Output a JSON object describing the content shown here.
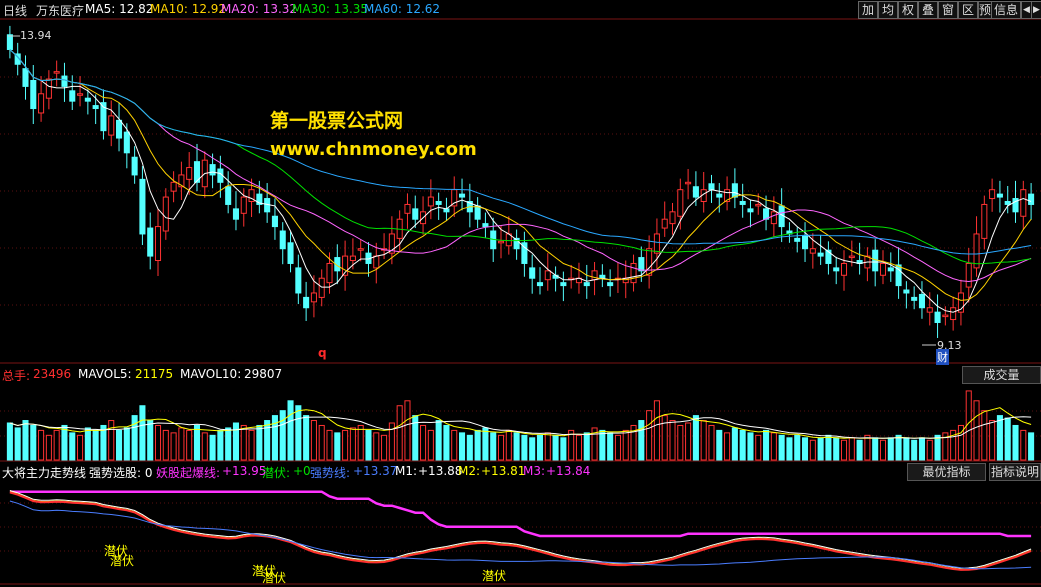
{
  "header": {
    "period": "日线",
    "stock": "万东医疗",
    "ma": [
      {
        "label": "MA5:",
        "value": "12.82",
        "color": "#ffffff"
      },
      {
        "label": "MA10:",
        "value": "12.92",
        "color": "#ffd200"
      },
      {
        "label": "MA20:",
        "value": "13.32",
        "color": "#ff66ff"
      },
      {
        "label": "MA30:",
        "value": "13.35",
        "color": "#00e000"
      },
      {
        "label": "MA60:",
        "value": "12.62",
        "color": "#2aa8ff"
      }
    ],
    "buttons": [
      "加",
      "均",
      "权",
      "叠",
      "窗",
      "区",
      "预",
      "信息"
    ],
    "nav_left": "◀",
    "nav_right": "▶"
  },
  "price_panel": {
    "high_label": "13.94",
    "low_label": "9.13",
    "q_marker": "q",
    "cai_marker": "财"
  },
  "watermark": {
    "line1": "第一股票公式网",
    "line2": "www.chnmoney.com"
  },
  "volume_panel": {
    "labels": [
      {
        "text": "总手:",
        "color": "#ff3030"
      },
      {
        "text": "23496",
        "color": "#ff3030"
      },
      {
        "text": "MAVOL5:",
        "color": "#ffffff"
      },
      {
        "text": "21175",
        "color": "#ffff00"
      },
      {
        "text": "MAVOL10:",
        "color": "#ffffff"
      },
      {
        "text": "29807",
        "color": "#ffffff"
      }
    ],
    "button": "成交量"
  },
  "indicator_panel": {
    "labels": [
      {
        "text": "大将主力走势线",
        "color": "#ffffff"
      },
      {
        "text": "强势选股: 0",
        "color": "#ffffff"
      },
      {
        "text": "妖股起爆线:",
        "color": "#ff33ff"
      },
      {
        "text": "+13.95",
        "color": "#ff33ff"
      },
      {
        "text": "潜伏:",
        "color": "#00e000"
      },
      {
        "text": "+0",
        "color": "#00e000"
      },
      {
        "text": "强势线:",
        "color": "#4a7dff"
      },
      {
        "text": "+13.37",
        "color": "#4a7dff"
      },
      {
        "text": "M1:",
        "color": "#ffffff"
      },
      {
        "text": "+13.88",
        "color": "#ffffff"
      },
      {
        "text": "M2:",
        "color": "#ffff00"
      },
      {
        "text": "+13.81",
        "color": "#ffff00"
      },
      {
        "text": "M3:",
        "color": "#ff33ff"
      },
      {
        "text": "+13.84",
        "color": "#ff33ff"
      }
    ],
    "buttons": [
      "最优指标",
      "指标说明"
    ],
    "qianfu_tags": [
      "潜伏",
      "潜伏",
      "潜伏",
      "潜伏",
      "潜伏"
    ]
  },
  "chart_data": {
    "type": "candlestick",
    "price_range": [
      9.13,
      13.94
    ],
    "candle_close": [
      13.7,
      13.5,
      13.2,
      12.9,
      13.1,
      13.3,
      13.4,
      13.2,
      13.0,
      13.1,
      13.0,
      12.9,
      12.6,
      12.8,
      12.5,
      12.3,
      12.0,
      11.2,
      10.9,
      11.3,
      11.7,
      11.9,
      12.0,
      12.1,
      11.9,
      12.2,
      12.0,
      11.9,
      11.6,
      11.4,
      11.7,
      11.8,
      11.6,
      11.5,
      11.3,
      11.0,
      10.8,
      10.4,
      10.2,
      10.4,
      10.6,
      10.8,
      10.7,
      10.9,
      10.9,
      11.0,
      10.8,
      10.9,
      11.0,
      11.2,
      11.4,
      11.6,
      11.4,
      11.5,
      11.7,
      11.6,
      11.5,
      11.8,
      11.7,
      11.5,
      11.4,
      11.3,
      11.0,
      11.1,
      11.2,
      11.0,
      10.8,
      10.6,
      10.5,
      10.7,
      10.6,
      10.5,
      10.6,
      10.6,
      10.5,
      10.7,
      10.6,
      10.5,
      10.6,
      10.6,
      10.8,
      10.7,
      11.0,
      11.2,
      11.4,
      11.5,
      11.8,
      11.9,
      11.7,
      11.8,
      11.8,
      11.7,
      11.8,
      11.7,
      11.6,
      11.5,
      11.6,
      11.4,
      11.5,
      11.3,
      11.2,
      11.1,
      11.0,
      11.0,
      10.9,
      10.8,
      10.7,
      10.8,
      10.9,
      10.8,
      10.9,
      10.7,
      10.8,
      10.7,
      10.5,
      10.4,
      10.3,
      10.2,
      10.2,
      10.0,
      10.1,
      10.2,
      10.4,
      10.8,
      11.2,
      11.6,
      11.8,
      11.7,
      11.6,
      11.5,
      11.8,
      11.6
    ],
    "volume": [
      15,
      13,
      16,
      14,
      12,
      10,
      12,
      14,
      11,
      10,
      13,
      12,
      14,
      16,
      12,
      13,
      18,
      22,
      16,
      14,
      12,
      11,
      13,
      12,
      14,
      11,
      10,
      12,
      13,
      15,
      14,
      12,
      14,
      16,
      18,
      20,
      24,
      22,
      18,
      16,
      14,
      12,
      11,
      12,
      13,
      14,
      12,
      11,
      10,
      15,
      22,
      24,
      18,
      14,
      12,
      16,
      14,
      12,
      11,
      10,
      12,
      13,
      11,
      10,
      12,
      11,
      10,
      9,
      10,
      11,
      10,
      9,
      12,
      10,
      11,
      13,
      12,
      11,
      10,
      12,
      14,
      16,
      20,
      24,
      18,
      16,
      14,
      15,
      18,
      16,
      14,
      12,
      11,
      13,
      12,
      11,
      10,
      12,
      11,
      10,
      9,
      10,
      9,
      8,
      9,
      10,
      9,
      8,
      9,
      8,
      10,
      9,
      8,
      9,
      10,
      9,
      8,
      9,
      8,
      10,
      11,
      12,
      14,
      28,
      24,
      20,
      16,
      18,
      17,
      14,
      12,
      11
    ]
  }
}
